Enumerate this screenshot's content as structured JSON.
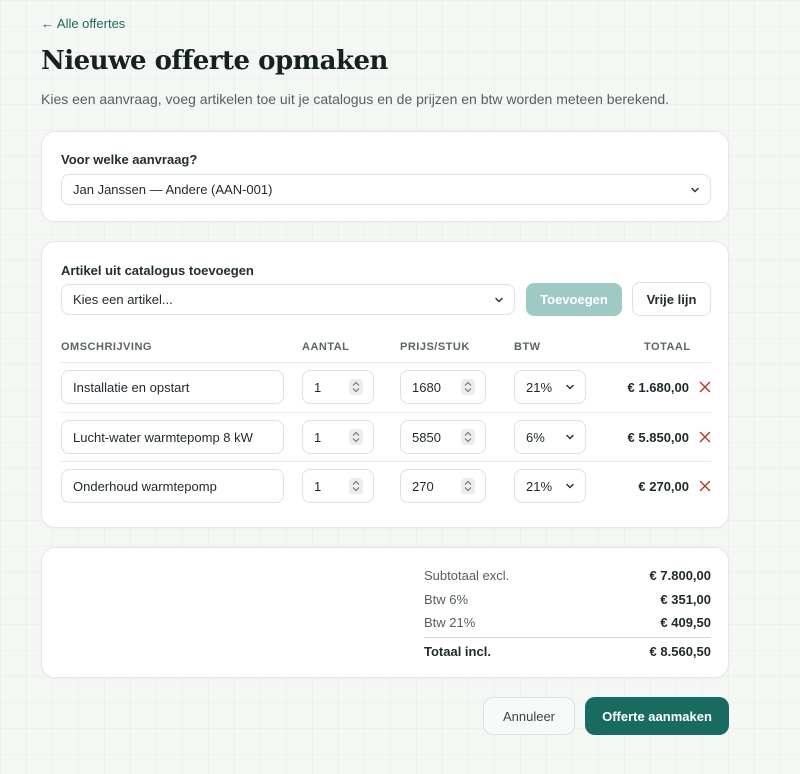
{
  "nav": {
    "back_label": "← Alle offertes"
  },
  "header": {
    "title": "Nieuwe offerte opmaken",
    "subtitle": "Kies een aanvraag, voeg artikelen toe uit je catalogus en de prijzen en btw worden meteen berekend."
  },
  "request": {
    "label": "Voor welke aanvraag?",
    "selected": "Jan Janssen — Andere (AAN-001)"
  },
  "catalog": {
    "label": "Artikel uit catalogus toevoegen",
    "placeholder": "Kies een artikel...",
    "add_label": "Toevoegen",
    "free_label": "Vrije lijn"
  },
  "table": {
    "headers": {
      "description": "OMSCHRIJVING",
      "qty": "AANTAL",
      "price": "PRIJS/STUK",
      "vat": "BTW",
      "total": "TOTAAL"
    },
    "rows": [
      {
        "description": "Installatie en opstart",
        "qty": "1",
        "price": "1680",
        "vat": "21%",
        "total": "€ 1.680,00"
      },
      {
        "description": "Lucht-water warmtepomp 8 kW",
        "qty": "1",
        "price": "5850",
        "vat": "6%",
        "total": "€ 5.850,00"
      },
      {
        "description": "Onderhoud warmtepomp",
        "qty": "1",
        "price": "270",
        "vat": "21%",
        "total": "€ 270,00"
      }
    ]
  },
  "summary": {
    "subtotal_label": "Subtotaal excl.",
    "subtotal_value": "€ 7.800,00",
    "vat6_label": "Btw 6%",
    "vat6_value": "€ 351,00",
    "vat21_label": "Btw 21%",
    "vat21_value": "€ 409,50",
    "total_label": "Totaal incl.",
    "total_value": "€ 8.560,50"
  },
  "actions": {
    "cancel_label": "Annuleer",
    "create_label": "Offerte aanmaken"
  },
  "colors": {
    "accent": "#1a6b5f",
    "accent_disabled": "#9fc9c3",
    "danger": "#c0392b"
  }
}
